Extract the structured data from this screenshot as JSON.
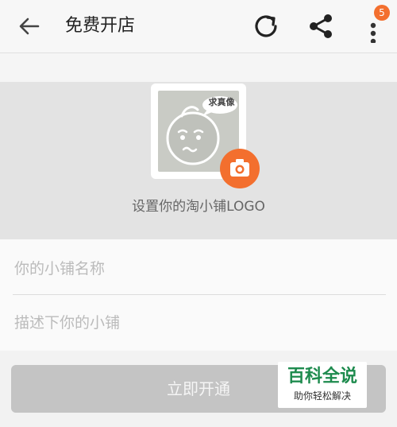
{
  "header": {
    "title": "免费开店",
    "back_icon": "arrow-left-icon",
    "refresh_icon": "refresh-icon",
    "share_icon": "share-icon",
    "more_icon": "more-vertical-icon",
    "notification_count": "5"
  },
  "logo": {
    "placeholder_bubble_text": "求真像",
    "camera_icon": "camera-icon",
    "hint": "设置你的淘小铺LOGO"
  },
  "form": {
    "name_placeholder": "你的小铺名称",
    "desc_placeholder": "描述下你的小铺"
  },
  "actions": {
    "submit_label": "立即开通"
  },
  "watermark": {
    "title": "百科全说",
    "subtitle": "助你轻松解决"
  },
  "colors": {
    "accent": "#f36f2e",
    "disabled_button": "#c4c4c4",
    "watermark_green": "#1e8b4e"
  }
}
